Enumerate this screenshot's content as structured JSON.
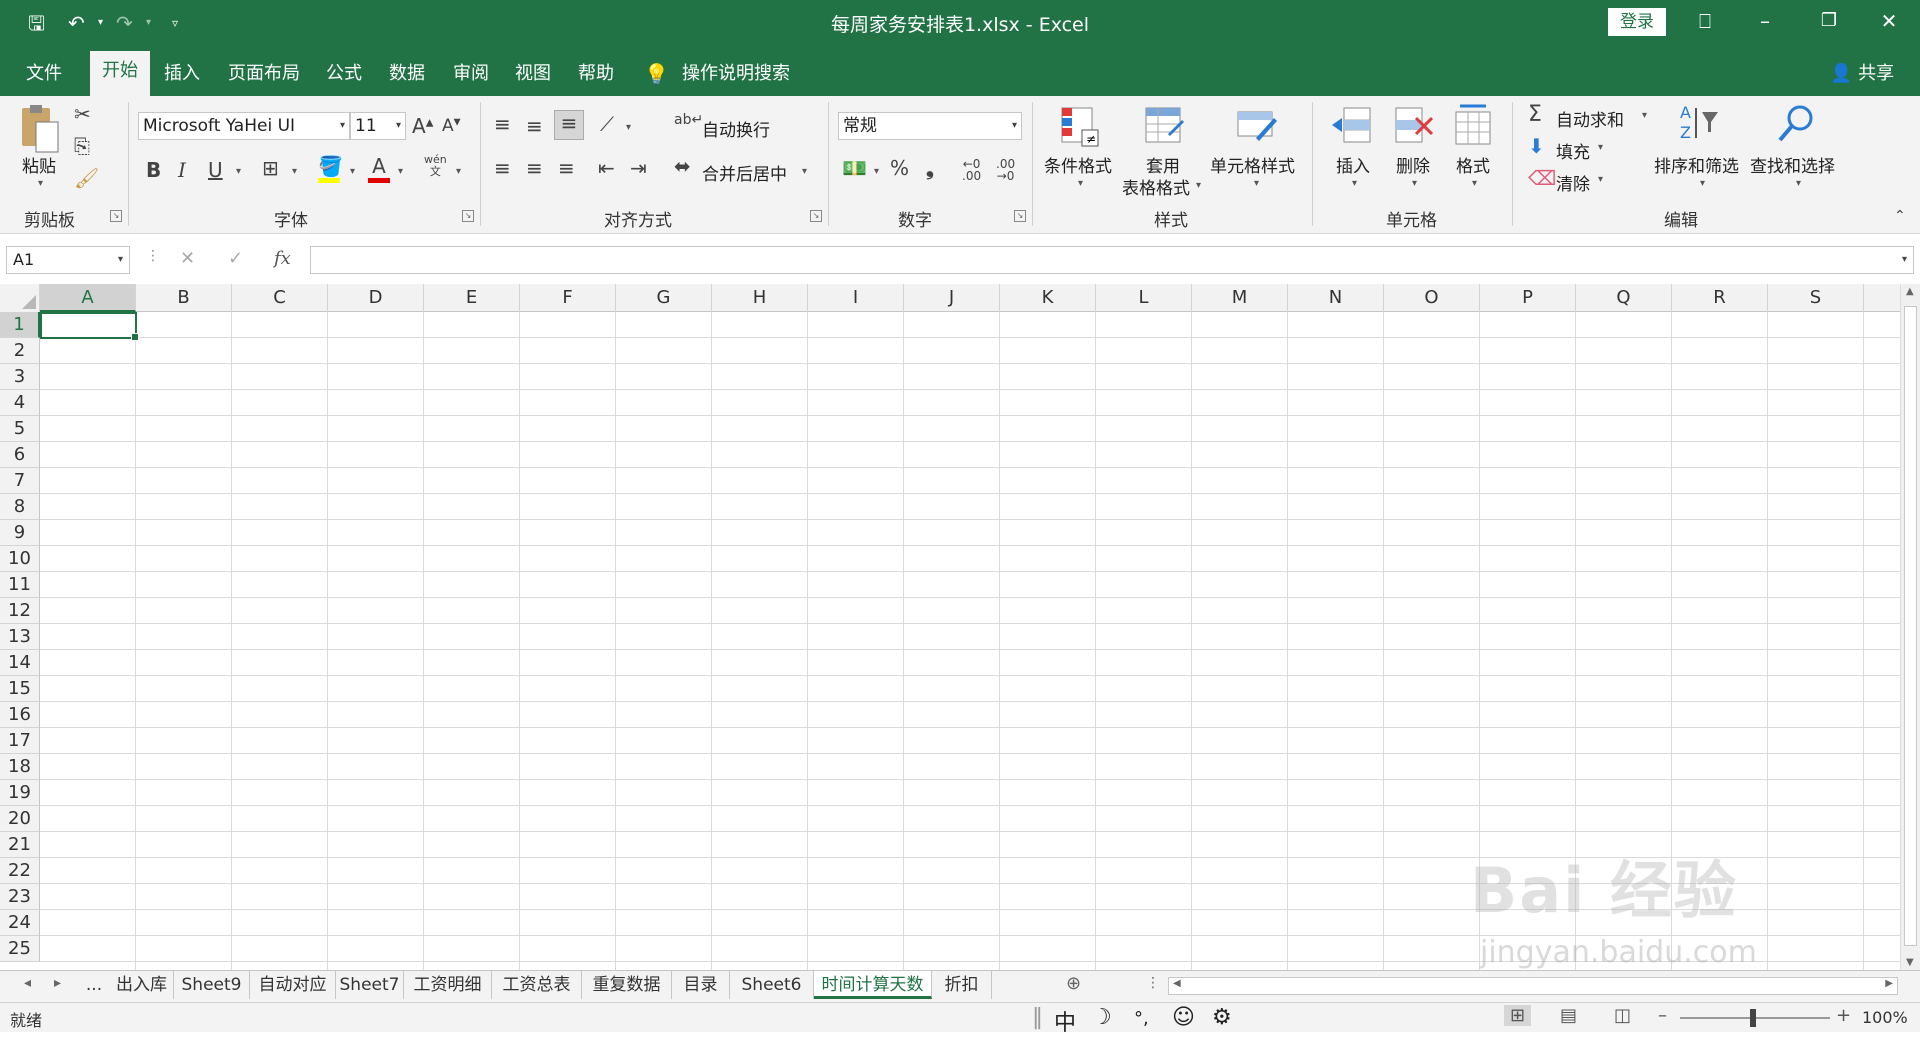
{
  "window": {
    "title": "每周家务安排表1.xlsx  -  Excel",
    "login_label": "登录"
  },
  "tabs": [
    "文件",
    "开始",
    "插入",
    "页面布局",
    "公式",
    "数据",
    "审阅",
    "视图",
    "帮助"
  ],
  "active_tab": "开始",
  "tell_me": "操作说明搜索",
  "share_label": "共享",
  "ribbon": {
    "clipboard": {
      "paste": "粘贴",
      "label": "剪贴板"
    },
    "font": {
      "name": "Microsoft YaHei UI",
      "size": "11",
      "label": "字体",
      "bold": "B",
      "italic": "I",
      "underline": "U",
      "phonetic": "wén"
    },
    "alignment": {
      "wrap": "自动换行",
      "merge": "合并后居中",
      "label": "对齐方式"
    },
    "number": {
      "format": "常规",
      "label": "数字",
      "percent": "%",
      "comma": "❟"
    },
    "styles": {
      "conditional": "条件格式",
      "table_line1": "套用",
      "table_line2": "表格格式",
      "cell_styles": "单元格样式",
      "label": "样式"
    },
    "cells": {
      "insert": "插入",
      "delete": "删除",
      "format": "格式",
      "label": "单元格"
    },
    "editing": {
      "autosum": "自动求和",
      "fill": "填充",
      "clear": "清除",
      "sort": "排序和筛选",
      "find": "查找和选择",
      "label": "编辑"
    }
  },
  "formula_bar": {
    "name_box": "A1",
    "fx": "fx",
    "value": ""
  },
  "columns": [
    "A",
    "B",
    "C",
    "D",
    "E",
    "F",
    "G",
    "H",
    "I",
    "J",
    "K",
    "L",
    "M",
    "N",
    "O",
    "P",
    "Q",
    "R",
    "S"
  ],
  "rows": [
    "1",
    "2",
    "3",
    "4",
    "5",
    "6",
    "7",
    "8",
    "9",
    "10",
    "11",
    "12",
    "13",
    "14",
    "15",
    "16",
    "17",
    "18",
    "19",
    "20",
    "21",
    "22",
    "23",
    "24",
    "25"
  ],
  "selected_cell": "A1",
  "sheets": [
    "...",
    "出入库",
    "Sheet9",
    "自动对应",
    "Sheet7",
    "工资明细",
    "工资总表",
    "重复数据",
    "目录",
    "Sheet6",
    "时间计算天数",
    "折扣"
  ],
  "active_sheet": "时间计算天数",
  "status": {
    "ready": "就绪",
    "zoom": "100%"
  },
  "ime": {
    "lang": "中",
    "punct": "°,"
  },
  "watermark": {
    "text": "Bai 经验",
    "url": "jingyan.baidu.com"
  }
}
